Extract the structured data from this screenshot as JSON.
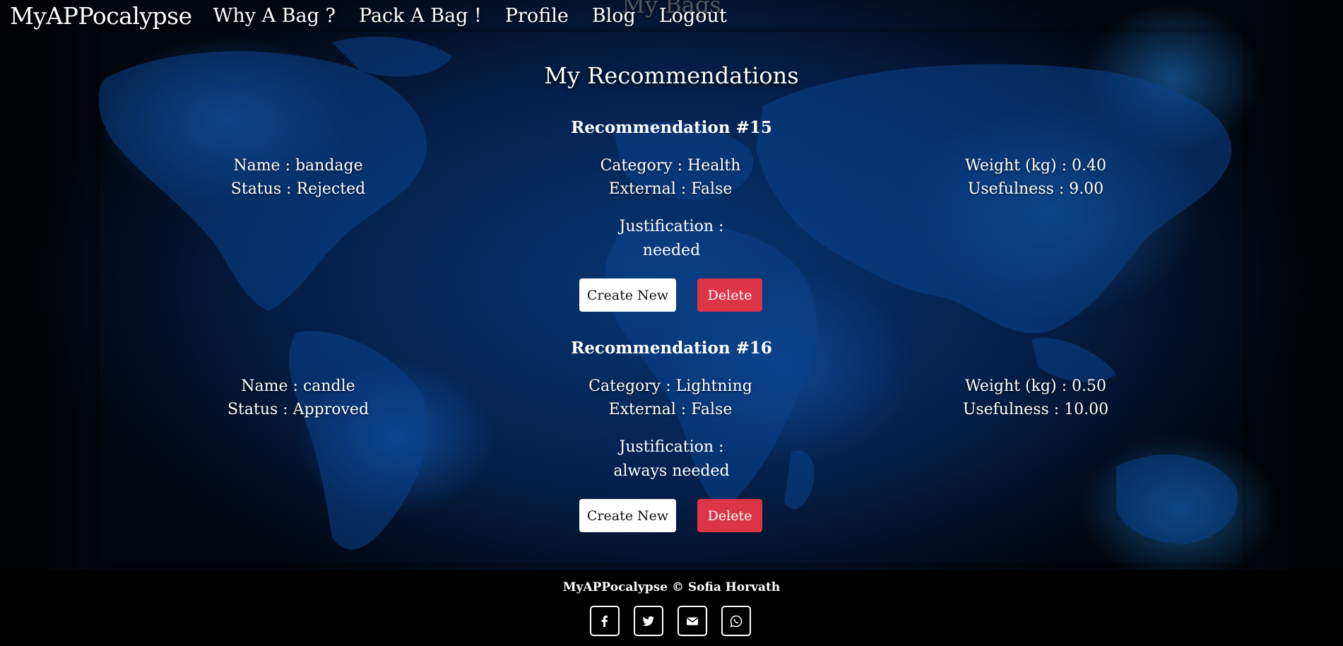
{
  "header": {
    "ghost_title": "My Bags",
    "brand": "MyAPPocalypse",
    "nav": [
      {
        "label": "Why A Bag ?"
      },
      {
        "label": "Pack A Bag !"
      },
      {
        "label": "Profile"
      },
      {
        "label": "Blog"
      },
      {
        "label": "Logout"
      }
    ]
  },
  "main": {
    "title": "My Recommendations",
    "recommendations": [
      {
        "title": "Recommendation #15",
        "name": "Name : bandage",
        "status": "Status : Rejected",
        "category": "Category : Health",
        "external": "External : False",
        "weight": "Weight (kg) : 0.40",
        "usefulness": "Usefulness : 9.00",
        "justification_label": "Justification :",
        "justification": "needed",
        "create_label": "Create New",
        "delete_label": "Delete"
      },
      {
        "title": "Recommendation #16",
        "name": "Name : candle",
        "status": "Status : Approved",
        "category": "Category : Lightning",
        "external": "External : False",
        "weight": "Weight (kg) : 0.50",
        "usefulness": "Usefulness : 10.00",
        "justification_label": "Justification :",
        "justification": "always needed",
        "create_label": "Create New",
        "delete_label": "Delete"
      }
    ]
  },
  "footer": {
    "copyright": "MyAPPocalypse © Sofia Horvath",
    "socials": [
      "facebook-icon",
      "twitter-icon",
      "mail-icon",
      "whatsapp-icon"
    ]
  },
  "colors": {
    "danger": "#dc3545",
    "background": "#06275a"
  }
}
